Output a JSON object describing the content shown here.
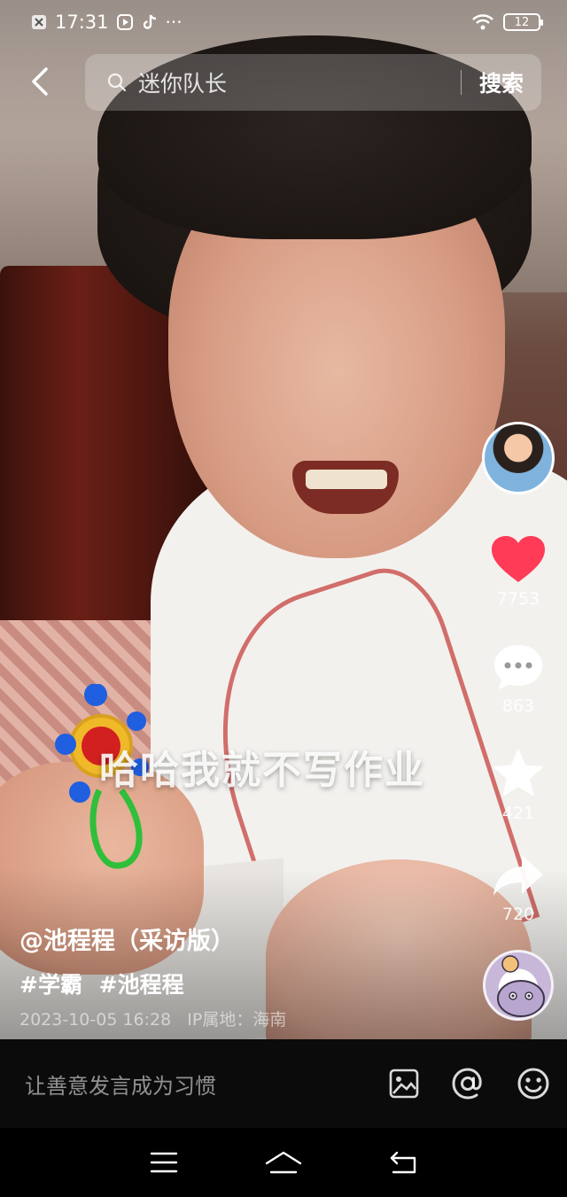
{
  "status_bar": {
    "time": "17:31",
    "more": "···",
    "battery": "12"
  },
  "search": {
    "query": "迷你队长",
    "button": "搜索"
  },
  "video": {
    "caption": "哈哈我就不写作业"
  },
  "rail": {
    "likes": "7753",
    "comments": "863",
    "favorites": "421",
    "shares": "720",
    "like_color": "#ff3b57"
  },
  "post": {
    "author": "@池程程（采访版）",
    "tags": [
      "#学霸",
      "#池程程"
    ],
    "date": "2023-10-05 16:28",
    "location": "IP属地：海南"
  },
  "comment_bar": {
    "placeholder": "让善意发言成为习惯"
  },
  "icons": {
    "back": "back-arrow-icon",
    "search": "search-icon",
    "heart": "heart-icon",
    "comment": "comment-bubble-icon",
    "star": "star-icon",
    "share": "share-arrow-icon",
    "image": "image-icon",
    "at": "at-icon",
    "emoji": "emoji-icon"
  }
}
